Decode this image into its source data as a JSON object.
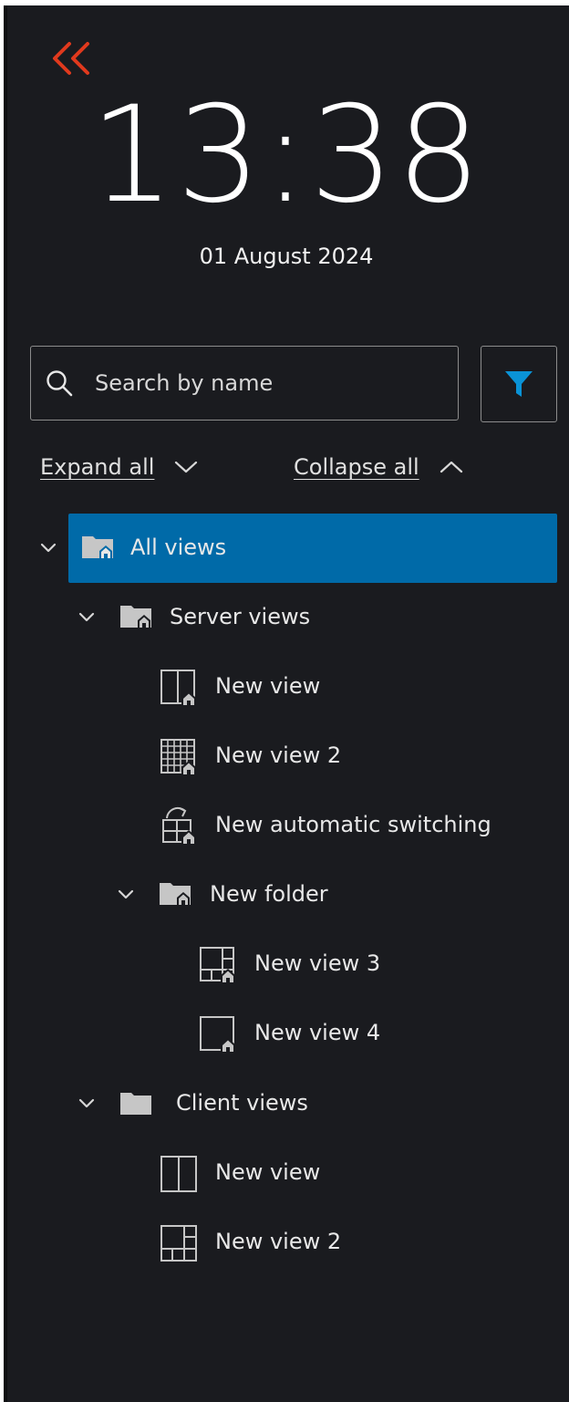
{
  "clock": {
    "time": "13:38",
    "date": "01 August 2024"
  },
  "search": {
    "placeholder": "Search by name",
    "value": ""
  },
  "tree_actions": {
    "expand_all": "Expand all",
    "collapse_all": "Collapse all"
  },
  "colors": {
    "background": "#1a1b1f",
    "accent_red": "#e0391d",
    "filter_blue": "#0a93d6",
    "selection_blue": "#006aa8",
    "icon_gray": "#c6c6c6"
  },
  "icons": {
    "collapse_toggle": "double-chevron-left-icon",
    "search": "magnifier-icon",
    "filter": "funnel-icon",
    "expand_all": "chevron-down-icon",
    "collapse_all": "chevron-up-icon"
  },
  "tree": [
    {
      "label": "All views",
      "icon": "server-folder-icon",
      "expanded": true,
      "selected": true
    },
    {
      "label": "Server views",
      "icon": "server-folder-icon",
      "expanded": true,
      "selected": false
    },
    {
      "label": "New view",
      "icon": "server-view-2-pane-icon",
      "selected": false
    },
    {
      "label": "New view 2",
      "icon": "server-view-grid-icon",
      "selected": false
    },
    {
      "label": "New automatic switching",
      "icon": "automatic-switching-icon",
      "selected": false
    },
    {
      "label": "New folder",
      "icon": "server-folder-icon",
      "expanded": true,
      "selected": false
    },
    {
      "label": "New view 3",
      "icon": "server-view-4-pane-icon",
      "selected": false
    },
    {
      "label": "New view 4",
      "icon": "server-view-1-pane-icon",
      "selected": false
    },
    {
      "label": "Client views",
      "icon": "folder-icon",
      "expanded": true,
      "selected": false
    },
    {
      "label": "New view",
      "icon": "view-2-pane-icon",
      "selected": false
    },
    {
      "label": "New view 2",
      "icon": "view-4-pane-icon",
      "selected": false
    }
  ]
}
